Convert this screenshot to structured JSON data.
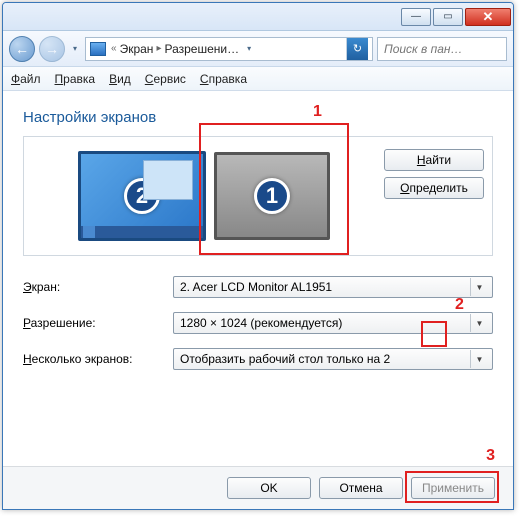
{
  "titlebar": {
    "minimize_glyph": "—",
    "maximize_glyph": "▭",
    "close_glyph": "✕"
  },
  "nav": {
    "back_glyph": "←",
    "fwd_glyph": "→",
    "drop_glyph": "▾",
    "refresh_glyph": "↻",
    "path_part1": "Экран",
    "path_part2": "Разрешени…"
  },
  "search": {
    "placeholder": "Поиск в пан…"
  },
  "menu": {
    "file": "айл",
    "file_u": "Ф",
    "edit": "равка",
    "edit_u": "П",
    "view": "ид",
    "view_u": "В",
    "tools": "ервис",
    "tools_u": "С",
    "help": "правка",
    "help_u": "С"
  },
  "section": {
    "title": "Настройки экранов"
  },
  "displays": {
    "primary_num": "1",
    "secondary_num": "2",
    "find_u": "Н",
    "find": "айти",
    "detect_u": "О",
    "detect": "пределить"
  },
  "form": {
    "screen_label_u": "Э",
    "screen_label": "кран:",
    "screen_value": "2. Acer LCD Monitor AL1951",
    "res_label_u": "Р",
    "res_label": "азрешение:",
    "res_value": "1280 × 1024 (рекомендуется)",
    "multi_label_u": "Н",
    "multi_label": "есколько экранов:",
    "multi_value": "Отобразить рабочий стол только на 2"
  },
  "footer": {
    "ok": "OK",
    "cancel": "Отмена",
    "apply": "Применить"
  },
  "annotations": {
    "a1": "1",
    "a2": "2",
    "a3": "3"
  }
}
